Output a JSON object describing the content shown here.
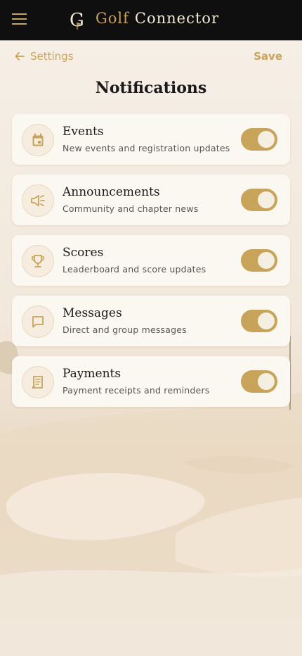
{
  "header": {
    "brand_first": "Golf",
    "brand_second": "Connector",
    "logo_letter": "G"
  },
  "nav": {
    "back_label": "Settings",
    "save_label": "Save"
  },
  "page": {
    "title": "Notifications"
  },
  "notifications": [
    {
      "label": "Events",
      "description": "New events and registration updates",
      "icon": "calendar-icon",
      "enabled": true
    },
    {
      "label": "Announcements",
      "description": "Community and chapter news",
      "icon": "megaphone-icon",
      "enabled": true
    },
    {
      "label": "Scores",
      "description": "Leaderboard and score updates",
      "icon": "trophy-icon",
      "enabled": true
    },
    {
      "label": "Messages",
      "description": "Direct and group messages",
      "icon": "chat-icon",
      "enabled": true
    },
    {
      "label": "Payments",
      "description": "Payment receipts and reminders",
      "icon": "receipt-icon",
      "enabled": true
    }
  ],
  "colors": {
    "accent": "#c8a45a",
    "header_bg": "#0f0f0f",
    "card_bg": "#fbf8f2"
  }
}
